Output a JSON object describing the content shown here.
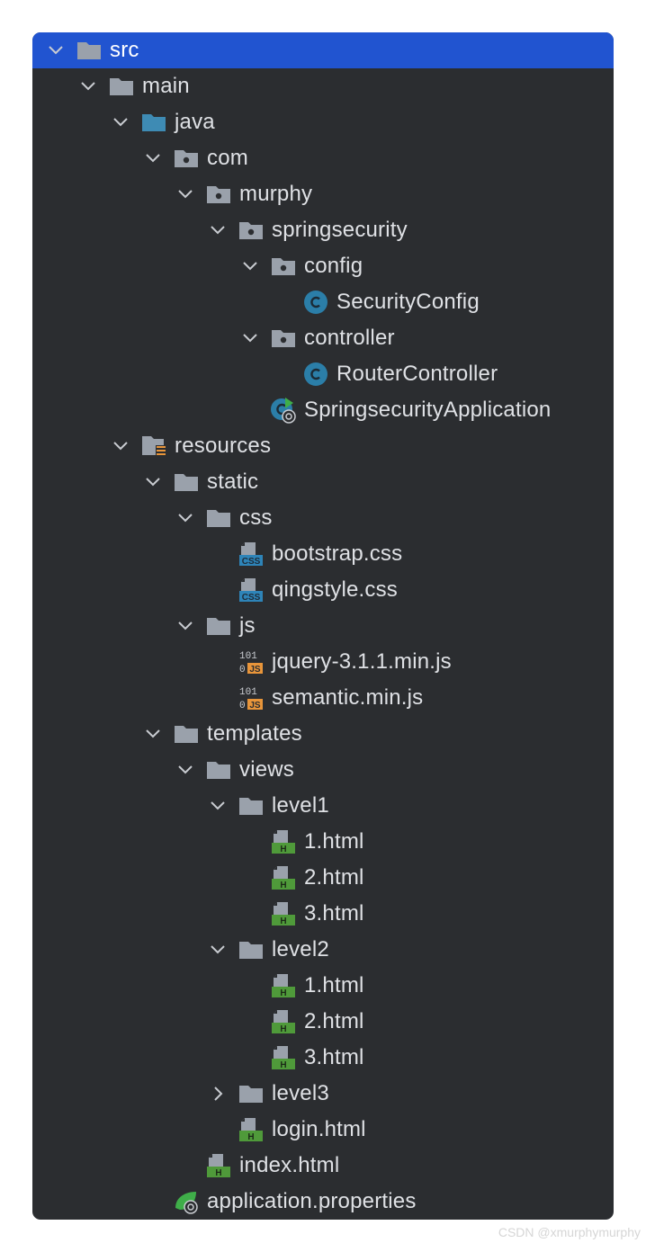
{
  "tree": [
    {
      "label": "src",
      "depth": 0,
      "expanded": true,
      "icon": "folder-gray",
      "selected": true
    },
    {
      "label": "main",
      "depth": 1,
      "expanded": true,
      "icon": "folder-gray"
    },
    {
      "label": "java",
      "depth": 2,
      "expanded": true,
      "icon": "folder-blue"
    },
    {
      "label": "com",
      "depth": 3,
      "expanded": true,
      "icon": "package"
    },
    {
      "label": "murphy",
      "depth": 4,
      "expanded": true,
      "icon": "package"
    },
    {
      "label": "springsecurity",
      "depth": 5,
      "expanded": true,
      "icon": "package"
    },
    {
      "label": "config",
      "depth": 6,
      "expanded": true,
      "icon": "package"
    },
    {
      "label": "SecurityConfig",
      "depth": 7,
      "icon": "class"
    },
    {
      "label": "controller",
      "depth": 6,
      "expanded": true,
      "icon": "package"
    },
    {
      "label": "RouterController",
      "depth": 7,
      "icon": "class"
    },
    {
      "label": "SpringsecurityApplication",
      "depth": 6,
      "icon": "spring-boot-class"
    },
    {
      "label": "resources",
      "depth": 2,
      "expanded": true,
      "icon": "folder-resources"
    },
    {
      "label": "static",
      "depth": 3,
      "expanded": true,
      "icon": "folder-gray"
    },
    {
      "label": "css",
      "depth": 4,
      "expanded": true,
      "icon": "folder-gray"
    },
    {
      "label": "bootstrap.css",
      "depth": 5,
      "icon": "css-file"
    },
    {
      "label": "qingstyle.css",
      "depth": 5,
      "icon": "css-file"
    },
    {
      "label": "js",
      "depth": 4,
      "expanded": true,
      "icon": "folder-gray"
    },
    {
      "label": "jquery-3.1.1.min.js",
      "depth": 5,
      "icon": "js-min-file"
    },
    {
      "label": "semantic.min.js",
      "depth": 5,
      "icon": "js-min-file"
    },
    {
      "label": "templates",
      "depth": 3,
      "expanded": true,
      "icon": "folder-gray"
    },
    {
      "label": "views",
      "depth": 4,
      "expanded": true,
      "icon": "folder-gray"
    },
    {
      "label": "level1",
      "depth": 5,
      "expanded": true,
      "icon": "folder-gray"
    },
    {
      "label": "1.html",
      "depth": 6,
      "icon": "html-file"
    },
    {
      "label": "2.html",
      "depth": 6,
      "icon": "html-file"
    },
    {
      "label": "3.html",
      "depth": 6,
      "icon": "html-file"
    },
    {
      "label": "level2",
      "depth": 5,
      "expanded": true,
      "icon": "folder-gray"
    },
    {
      "label": "1.html",
      "depth": 6,
      "icon": "html-file"
    },
    {
      "label": "2.html",
      "depth": 6,
      "icon": "html-file"
    },
    {
      "label": "3.html",
      "depth": 6,
      "icon": "html-file"
    },
    {
      "label": "level3",
      "depth": 5,
      "expanded": false,
      "icon": "folder-gray"
    },
    {
      "label": "login.html",
      "depth": 5,
      "icon": "html-file"
    },
    {
      "label": "index.html",
      "depth": 4,
      "icon": "html-file"
    },
    {
      "label": "application.properties",
      "depth": 3,
      "icon": "spring-properties-file"
    }
  ],
  "watermark": "CSDN @xmurphymurphy",
  "colors": {
    "panel_bg": "#2b2d30",
    "selection": "#2154d0",
    "text": "#dfe1e5",
    "folder": "#9aa1ab",
    "folder_blue": "#3e8bb4",
    "class_icon": "#2b7ea8",
    "css_badge": "#2e84b8",
    "js_badge": "#e8953a",
    "html_badge": "#4f9a3a"
  }
}
